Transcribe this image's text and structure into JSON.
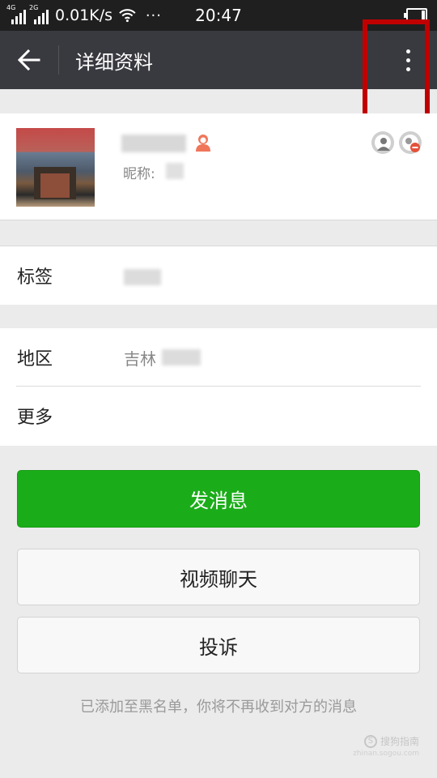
{
  "status_bar": {
    "network_1": "4G",
    "network_2": "2G",
    "speed": "0.01K/s",
    "more_dots": "···",
    "time": "20:47"
  },
  "nav": {
    "title": "详细资料"
  },
  "profile": {
    "nickname_label": "昵称:"
  },
  "rows": {
    "tag_label": "标签",
    "region_label": "地区",
    "region_value": "吉林",
    "more_label": "更多"
  },
  "buttons": {
    "send_message": "发消息",
    "video_chat": "视频聊天",
    "report": "投诉"
  },
  "blacklist_note": "已添加至黑名单，你将不再收到对方的消息",
  "watermark": {
    "text": "搜狗指南",
    "url": "zhinan.sogou.com"
  },
  "colors": {
    "nav_bg": "#393a3f",
    "primary_green": "#1aad19",
    "highlight_red": "#c00000",
    "gender_icon": "#f0765a"
  }
}
